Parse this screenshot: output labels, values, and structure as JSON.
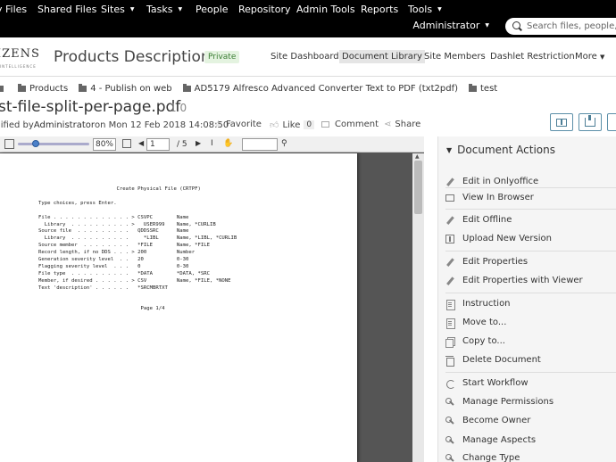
{
  "topnav": {
    "items": [
      {
        "label": "y Files",
        "caret": false
      },
      {
        "label": "Shared Files",
        "caret": false
      },
      {
        "label": "Sites",
        "caret": true
      },
      {
        "label": "Tasks",
        "caret": true
      },
      {
        "label": "People",
        "caret": false
      },
      {
        "label": "Repository",
        "caret": false
      },
      {
        "label": "Admin Tools",
        "caret": false
      },
      {
        "label": "Reports",
        "caret": false
      },
      {
        "label": "Tools",
        "caret": true
      }
    ],
    "user": "Administrator",
    "search_placeholder": "Search files, people, sites"
  },
  "site": {
    "logo_text": "IZENS",
    "logo_sub": "INTELLIGENCE",
    "title": "Products Description",
    "visibility": "Private",
    "nav": [
      {
        "label": "Site Dashboard",
        "active": false
      },
      {
        "label": "Document Library",
        "active": true
      },
      {
        "label": "Site Members",
        "active": false
      },
      {
        "label": "Dashlet Restriction",
        "active": false
      },
      {
        "label": "More",
        "active": false
      }
    ]
  },
  "breadcrumb": [
    "Products",
    "4 - Publish on web",
    "AD5179 Alfresco Advanced Converter Text to PDF (txt2pdf)",
    "test"
  ],
  "document": {
    "title": "st-file-split-per-page.pdf",
    "version": "1.0",
    "modified_prefix": "lified by ",
    "modified_by": "Administrator",
    "modified_on": " on Mon 12 Feb 2018 14:08:50",
    "favorite": "Favorite",
    "like": "Like",
    "like_count": "0",
    "comment": "Comment",
    "share": "Share"
  },
  "viewer": {
    "zoom": "80%",
    "page": "1",
    "total": "/ 5",
    "zoom_level_percent": 25,
    "page_text": "                          Create Physical File (CRTPF)\n\nType choices, press Enter.\n\nFile . . . . . . . . . . . . . > CSVPC        Name\n  Library  . . . . . . . . . . >   USER999    Name, *CURLIB\nSource file  . . . . . . . . .   QDDSSRC      Name\n  Library  . . . . . . . . . .     *LIBL      Name, *LIBL, *CURLIB\nSource member  . . . . . . . .   *FILE        Name, *FILE\nRecord length, if no DDS . . . > 200          Number\nGeneration severity level  . .   20           0-30\nFlagging severity level  . . .   0            0-30\nFile type  . . . . . . . . . .   *DATA        *DATA, *SRC\nMember, if desired . . . . . . > CSV          Name, *FILE, *NONE\nText 'description' . . . . . .   *SRCMBRTXT\n\n\n                                  Page 1/4"
  },
  "actions": {
    "heading": "Document Actions",
    "groups": [
      [
        {
          "label": "Edit in Onlyoffice",
          "icon": "pencil-icon"
        }
      ],
      [
        {
          "label": "View In Browser",
          "icon": "monitor-icon"
        }
      ],
      [
        {
          "label": "Edit Offline",
          "icon": "pencil-icon"
        },
        {
          "label": "Upload New Version",
          "icon": "upload-icon"
        }
      ],
      [
        {
          "label": "Edit Properties",
          "icon": "pencil-icon"
        },
        {
          "label": "Edit Properties with Viewer",
          "icon": "pencil-icon"
        }
      ],
      [
        {
          "label": "Instruction",
          "icon": "document-icon"
        },
        {
          "label": "Move to...",
          "icon": "document-icon"
        },
        {
          "label": "Copy to...",
          "icon": "copy-icon"
        },
        {
          "label": "Delete Document",
          "icon": "trash-icon"
        }
      ],
      [
        {
          "label": "Start Workflow",
          "icon": "workflow-icon"
        },
        {
          "label": "Manage Permissions",
          "icon": "key-icon"
        },
        {
          "label": "Become Owner",
          "icon": "key-icon"
        },
        {
          "label": "Manage Aspects",
          "icon": "key-icon"
        },
        {
          "label": "Change Type",
          "icon": "key-icon"
        }
      ]
    ]
  }
}
